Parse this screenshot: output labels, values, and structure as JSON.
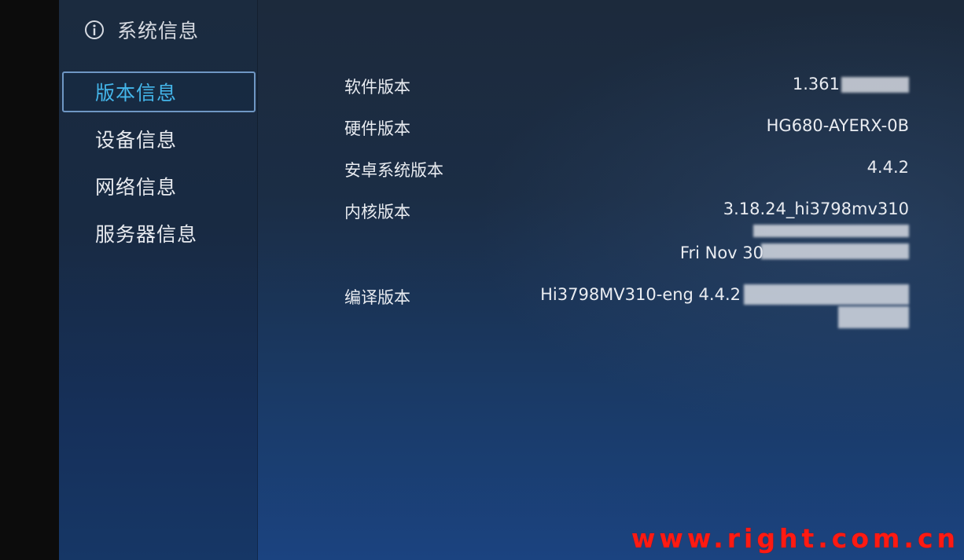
{
  "header": {
    "title": "系统信息",
    "icon": "info-icon"
  },
  "menu": {
    "items": [
      {
        "label": "版本信息",
        "selected": true
      },
      {
        "label": "设备信息",
        "selected": false
      },
      {
        "label": "网络信息",
        "selected": false
      },
      {
        "label": "服务器信息",
        "selected": false
      }
    ]
  },
  "details": {
    "software_version": {
      "label": "软件版本",
      "value": "1.361"
    },
    "hardware_version": {
      "label": "硬件版本",
      "value": "HG680-AYERX-0B"
    },
    "android_version": {
      "label": "安卓系统版本",
      "value": "4.4.2"
    },
    "kernel_version": {
      "label": "内核版本",
      "value": "3.18.24_hi3798mv310",
      "value_line3": "Fri Nov 30"
    },
    "build_version": {
      "label": "编译版本",
      "value": "Hi3798MV310-eng 4.4.2"
    }
  },
  "watermark": "www.right.com.cn",
  "colors": {
    "accent": "#44b6ea",
    "selection_border": "#6f97c4",
    "watermark": "#ff1a12"
  }
}
